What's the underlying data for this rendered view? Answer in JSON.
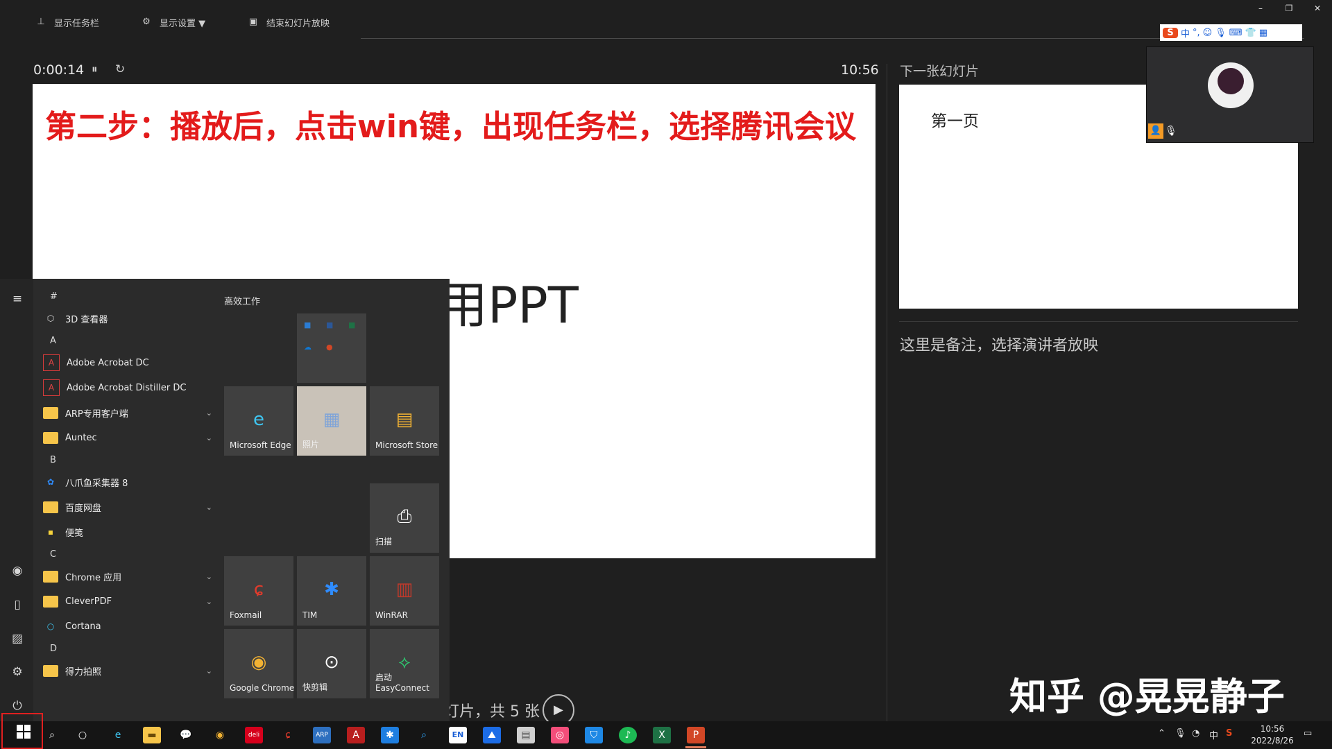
{
  "toolbar": {
    "show_taskbar": "显示任务栏",
    "display_settings": "显示设置 ▼",
    "end_slideshow": "结束幻灯片放映"
  },
  "presenter": {
    "elapsed": "0:00:14",
    "clock": "10:56",
    "slide_title": "第二步：播放后，点击win键，出现任务栏，选择腾讯会议",
    "slide_body": "演示用PPT",
    "next_label": "下一张幻灯片",
    "next_slide_text": "第一页",
    "notes": "这里是备注，选择演讲者放映",
    "slide_counter": "灯片，共 5 张"
  },
  "ime": {
    "logo": "S",
    "lang": "中"
  },
  "watermark": "知乎 @晃晃静子",
  "start_menu": {
    "tiles_header": "高效工作",
    "app_list": [
      {
        "type": "header",
        "label": "#"
      },
      {
        "type": "app",
        "label": "3D 查看器",
        "icon": "cube-icon"
      },
      {
        "type": "header",
        "label": "A"
      },
      {
        "type": "app",
        "label": "Adobe Acrobat DC",
        "icon": "acrobat-icon"
      },
      {
        "type": "app",
        "label": "Adobe Acrobat Distiller DC",
        "icon": "acrobat-icon"
      },
      {
        "type": "folder",
        "label": "ARP专用客户端"
      },
      {
        "type": "folder",
        "label": "Auntec"
      },
      {
        "type": "header",
        "label": "B"
      },
      {
        "type": "app",
        "label": "八爪鱼采集器 8",
        "icon": "octopus-icon"
      },
      {
        "type": "folder",
        "label": "百度网盘"
      },
      {
        "type": "app",
        "label": "便笺",
        "icon": "sticky-note-icon"
      },
      {
        "type": "header",
        "label": "C"
      },
      {
        "type": "folder",
        "label": "Chrome 应用"
      },
      {
        "type": "folder",
        "label": "CleverPDF"
      },
      {
        "type": "app",
        "label": "Cortana",
        "icon": "cortana-icon"
      },
      {
        "type": "header",
        "label": "D"
      },
      {
        "type": "folder",
        "label": "得力拍照"
      }
    ],
    "tiles": [
      {
        "label": "Microsoft Edge",
        "icon": "edge-icon"
      },
      {
        "label": "照片",
        "icon": "photos-icon"
      },
      {
        "label": "Microsoft Store",
        "icon": "store-icon"
      },
      {
        "label": "扫描",
        "icon": "scanner-icon"
      },
      {
        "label": "Foxmail",
        "icon": "foxmail-icon"
      },
      {
        "label": "TIM",
        "icon": "tim-icon"
      },
      {
        "label": "WinRAR",
        "icon": "winrar-icon"
      },
      {
        "label": "Google Chrome",
        "icon": "chrome-icon"
      },
      {
        "label": "快剪辑",
        "icon": "video-edit-icon"
      },
      {
        "label": "启动\nEasyConnect",
        "icon": "easyconnect-icon"
      }
    ]
  },
  "taskbar": {
    "tray_lang": "中",
    "time": "10:56",
    "date": "2022/8/26",
    "en_label": "EN"
  }
}
